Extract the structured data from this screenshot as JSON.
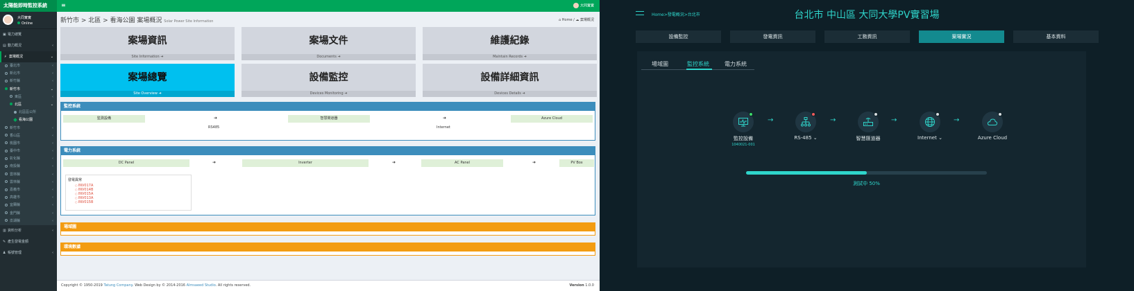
{
  "left": {
    "app_title": "太陽能即時監控系統",
    "user": {
      "name": "大同實實",
      "status": "Online"
    },
    "nav": [
      {
        "label": "電力總覽",
        "level": 1
      },
      {
        "label": "動力概況",
        "level": 1,
        "arrow": "‹"
      },
      {
        "label": "案場概況",
        "level": 1,
        "arrow": "⌄",
        "active": true
      },
      {
        "label": "臺北市",
        "level": 2,
        "arrow": "‹"
      },
      {
        "label": "新北市",
        "level": 2,
        "arrow": "‹"
      },
      {
        "label": "新竹縣",
        "level": 2,
        "arrow": "‹"
      },
      {
        "label": "新竹市",
        "level": 2,
        "arrow": "⌄",
        "highlight": true
      },
      {
        "label": "東區",
        "level": 3,
        "arrow": "‹"
      },
      {
        "label": "北區",
        "level": 3,
        "arrow": "⌄",
        "highlight": true
      },
      {
        "label": "北區區公所",
        "level": 4
      },
      {
        "label": "看海公園",
        "level": 4,
        "highlight": true
      },
      {
        "label": "新竹市",
        "level": 2,
        "arrow": "‹"
      },
      {
        "label": "香山區",
        "level": 2,
        "arrow": "‹"
      },
      {
        "label": "桃園市",
        "level": 2,
        "arrow": "‹"
      },
      {
        "label": "臺中市",
        "level": 2,
        "arrow": "‹"
      },
      {
        "label": "彰化縣",
        "level": 2,
        "arrow": "‹"
      },
      {
        "label": "南投縣",
        "level": 2,
        "arrow": "‹"
      },
      {
        "label": "雲林縣",
        "level": 2,
        "arrow": "‹"
      },
      {
        "label": "雲林縣",
        "level": 2,
        "arrow": "‹"
      },
      {
        "label": "嘉義市",
        "level": 2,
        "arrow": "‹"
      },
      {
        "label": "高雄市",
        "level": 2,
        "arrow": "‹"
      },
      {
        "label": "宜蘭縣",
        "level": 2,
        "arrow": "‹"
      },
      {
        "label": "金門縣",
        "level": 2,
        "arrow": "‹"
      },
      {
        "label": "澎湖縣",
        "level": 2,
        "arrow": "‹"
      },
      {
        "label": "資料分析",
        "level": 1,
        "arrow": "‹"
      },
      {
        "label": "產生發電金額",
        "level": 1
      },
      {
        "label": "帳號管理",
        "level": 1,
        "arrow": "‹"
      }
    ],
    "topbar_user": "大同實實",
    "breadcrumb": {
      "text": "新竹市 > 北區 > 看海公園 案場概況",
      "subtitle": "Solar Power Site Information"
    },
    "crumb_right": {
      "home": "⌂ Home",
      "sep": "/",
      "current": "☁ 案場概況"
    },
    "tiles": [
      {
        "title": "案場資訊",
        "footer": "Site Information ➜"
      },
      {
        "title": "案場文件",
        "footer": "Documents ➜"
      },
      {
        "title": "維護紀錄",
        "footer": "Maintain Records ➜"
      },
      {
        "title": "案場總覽",
        "footer": "Site Overview ➜"
      },
      {
        "title": "設備監控",
        "footer": "Devices Monitoring ➜"
      },
      {
        "title": "設備詳細資訊",
        "footer": "Devices Details ➜"
      }
    ],
    "monitor_box": {
      "title": "監控系統",
      "cells": [
        "監測設備",
        "智慧閘道器",
        "Azure Cloud"
      ],
      "arrow": "➜",
      "links": [
        "RS485",
        "Internet"
      ]
    },
    "power_box": {
      "title": "電力系統",
      "cells": [
        "DC Panel",
        "Inverter",
        "AC Panel",
        "PV Box"
      ],
      "arrow": "➜",
      "alarm_title": "發電異常",
      "alarms": [
        "INV017A",
        "INV014B",
        "INV015A",
        "INV013A",
        "INV015B"
      ]
    },
    "site_map_box": {
      "title": "場域圖"
    },
    "weather_box": {
      "title": "環境數據"
    },
    "footer": {
      "copyright_pre": "Copyright © 1950-2019",
      "company": "Tatung Company",
      "design_mid": ". Web Design by © 2014-2016",
      "studio": "Almsaeed Studio",
      "rights": ". All rights reserved.",
      "version_label": "Version",
      "version": "1.0.0"
    }
  },
  "right": {
    "breadcrumb": "Home>發電概況>台北市",
    "title": "台北市 中山區 大同大學PV實習場",
    "tabs": [
      {
        "label": "設備監控",
        "active": false
      },
      {
        "label": "發電資訊",
        "active": false
      },
      {
        "label": "工務資訊",
        "active": false
      },
      {
        "label": "案場實況",
        "active": true
      },
      {
        "label": "基本資料",
        "active": false
      }
    ],
    "subtabs": [
      {
        "label": "場域圖",
        "active": false
      },
      {
        "label": "監控系統",
        "active": true
      },
      {
        "label": "電力系統",
        "active": false
      }
    ],
    "nodes": [
      {
        "label": "監控設備",
        "sub": "1040021-001",
        "status_color": "#3ddc6a",
        "icon": "monitor-icon"
      },
      {
        "label": "RS-485 ⌄",
        "status_color": "#f15b5b",
        "icon": "network-icon"
      },
      {
        "label": "智慧匯道器",
        "status_color": "#d7dde0",
        "icon": "router-icon"
      },
      {
        "label": "Internet ⌄",
        "status_color": "#d7dde0",
        "icon": "globe-icon"
      },
      {
        "label": "Azure Cloud",
        "status_color": "#d7dde0",
        "icon": "cloud-icon"
      }
    ],
    "arrow": "→",
    "progress": {
      "value": 0.5,
      "text": "測試中 50%"
    },
    "colors": {
      "accent": "#2fd5cb",
      "background": "#0e1f27",
      "panel": "#14262f"
    }
  }
}
